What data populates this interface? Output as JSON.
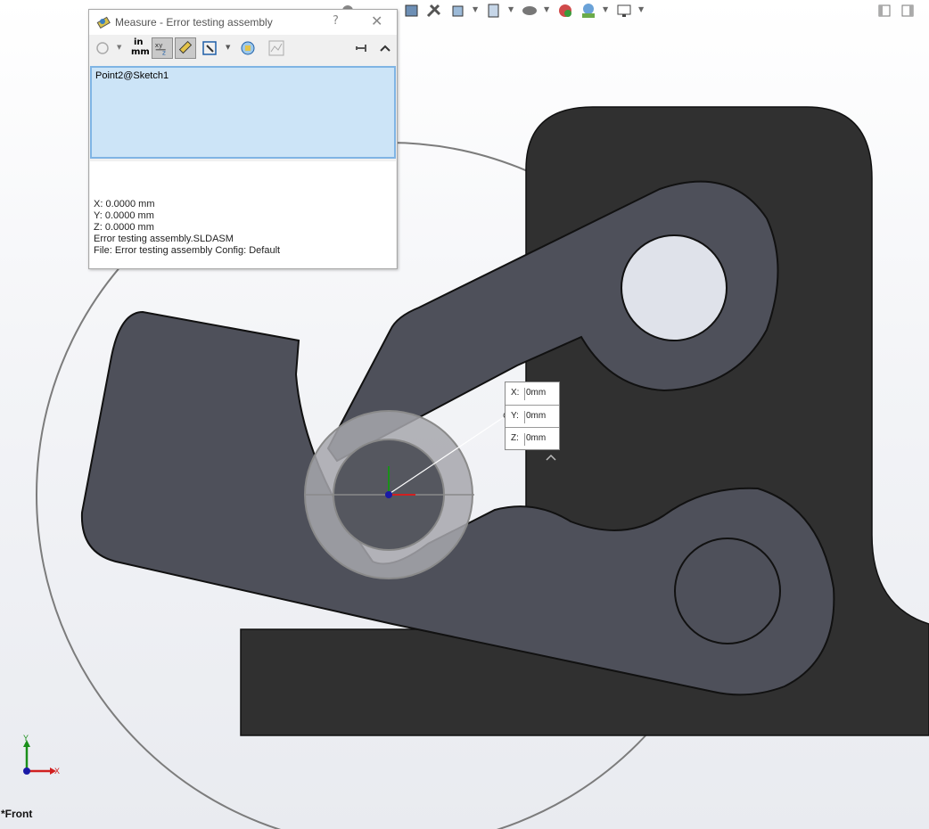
{
  "dialog": {
    "title": "Measure - Error testing assembly",
    "help": "?",
    "close": "✕",
    "units_top": "in",
    "units_bottom": "mm",
    "selection": "Point2@Sketch1",
    "results": [
      "X: 0.0000 mm",
      "Y: 0.0000 mm",
      "Z: 0.0000 mm",
      "Error testing assembly.SLDASM",
      "File: Error testing assembly Config: Default"
    ]
  },
  "tooltip": {
    "x_label": "X:",
    "x_value": "0mm",
    "y_label": "Y:",
    "y_value": "0mm",
    "z_label": "Z:",
    "z_value": "0mm"
  },
  "triad": {
    "x": "X",
    "y": "Y"
  },
  "view_label": "*Front",
  "colors": {
    "part_dark": "#303030",
    "part_gray": "#4e505a",
    "selection_bg": "#cce4f7",
    "axis_x": "#d12020",
    "axis_y": "#1a8f1a",
    "origin": "#1a1aa6"
  },
  "icons": [
    "home-icon",
    "tools-icon",
    "section-view-icon",
    "display-style-icon",
    "view-orientation-icon",
    "hide-show-icon",
    "appearance-icon",
    "scene-icon",
    "monitor-icon",
    "restore-icon",
    "maximize-icon"
  ]
}
